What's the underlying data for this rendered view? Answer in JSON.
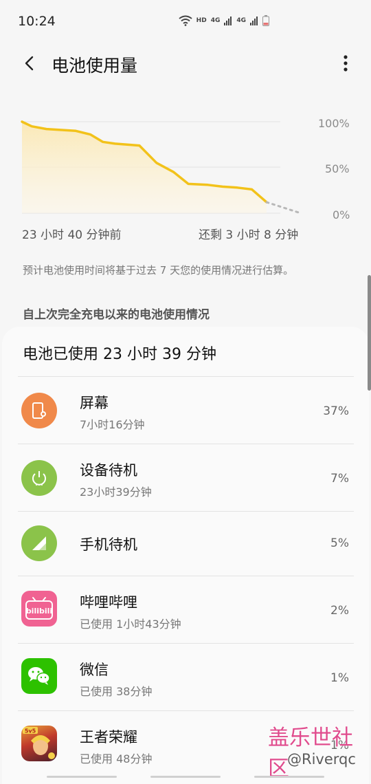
{
  "status_bar": {
    "time": "10:24",
    "hd_label": "HD",
    "net1": "4G",
    "net2": "4G"
  },
  "header": {
    "title": "电池使用量"
  },
  "chart_data": {
    "type": "area",
    "yticks": [
      "100%",
      "50%",
      "0%"
    ],
    "ylim": [
      0,
      100
    ],
    "start_label": "23 小时 40 分钟前",
    "end_label": "还剩 3 小时 8 分钟",
    "x": [
      0,
      0.04,
      0.1,
      0.22,
      0.28,
      0.33,
      0.38,
      0.48,
      0.55,
      0.62,
      0.68,
      0.76,
      0.82,
      0.88,
      0.94,
      1.0
    ],
    "y": [
      100,
      95,
      92,
      90,
      86,
      78,
      76,
      74,
      55,
      45,
      32,
      31,
      29,
      28,
      26,
      12
    ],
    "projection_x": [
      1.0,
      1.14
    ],
    "projection_y": [
      12,
      0
    ]
  },
  "estimate_note": "预计电池使用时间将基于过去 7 天您的使用情况进行估算。",
  "section_title": "自上次完全充电以来的电池使用情况",
  "summary": "电池已使用 23 小时 39 分钟",
  "items": [
    {
      "name": "屏幕",
      "sub": "7小时16分钟",
      "percent": "37%",
      "icon": "screen-icon",
      "color": "#f0894a"
    },
    {
      "name": "设备待机",
      "sub": "23小时39分钟",
      "percent": "7%",
      "icon": "power-icon",
      "color": "#8bc34a"
    },
    {
      "name": "手机待机",
      "sub": "",
      "percent": "5%",
      "icon": "signal-icon",
      "color": "#8bc34a"
    },
    {
      "name": "哔哩哔哩",
      "sub": "已使用 1小时43分钟",
      "percent": "2%",
      "icon": "bilibili-icon",
      "color": "#f06292"
    },
    {
      "name": "微信",
      "sub": "已使用 38分钟",
      "percent": "1%",
      "icon": "wechat-icon",
      "color": "#2dc100"
    },
    {
      "name": "王者荣耀",
      "sub": "已使用 48分钟",
      "percent": "1%",
      "icon": "game-icon",
      "color": "#c0392b"
    }
  ],
  "bilibili_logo_text": "bilibili",
  "game_badge": "5v5",
  "watermark": {
    "line1": "盖乐世社区",
    "line2": "@Riverqc"
  },
  "colors": {
    "accent": "#f2c21a",
    "fill": "#fbeec5"
  }
}
